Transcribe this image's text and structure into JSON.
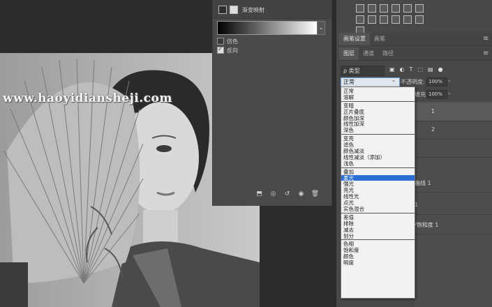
{
  "properties_panel": {
    "title": "渐变映射",
    "options": [
      {
        "label": "仿色",
        "checked": false
      },
      {
        "label": "反向",
        "checked": true
      }
    ],
    "footer_icons": [
      "clip-to-layer-icon",
      "eye-preview-icon",
      "reset-icon",
      "visibility-icon",
      "trash-icon"
    ]
  },
  "right_panel": {
    "top_tabs": [
      {
        "label": "画笔设置",
        "active": true
      },
      {
        "label": "画笔",
        "active": false
      }
    ],
    "layer_tabs": [
      {
        "label": "图层",
        "active": true
      },
      {
        "label": "通道",
        "active": false
      },
      {
        "label": "路径",
        "active": false
      }
    ],
    "filter": {
      "value": "ρ 类型"
    },
    "blend_mode": {
      "selected": "正常"
    },
    "opacity": {
      "label": "不透明度:",
      "value": "100%"
    },
    "fill": {
      "label": "填充:",
      "value": "100%"
    }
  },
  "layers": [
    {
      "fragment": "1",
      "selected": true
    },
    {
      "fragment": "2",
      "selected": false
    },
    {
      "fragment": "",
      "selected": false
    },
    {
      "fragment": "曲线 1",
      "selected": false
    },
    {
      "fragment": "1",
      "selected": false
    },
    {
      "fragment": "/饱和度 1",
      "selected": false
    }
  ],
  "blend_modes": [
    [
      "正常",
      "溶解"
    ],
    [
      "变暗",
      "正片叠底",
      "颜色加深",
      "线性加深",
      "深色"
    ],
    [
      "变亮",
      "滤色",
      "颜色减淡",
      "线性减淡（添加）",
      "浅色"
    ],
    [
      "叠加",
      "柔光",
      "强光",
      "亮光",
      "线性光",
      "点光",
      "实色混合"
    ],
    [
      "差值",
      "排除",
      "减去",
      "划分"
    ],
    [
      "色相",
      "饱和度",
      "颜色",
      "明度"
    ]
  ],
  "highlighted_mode": "柔光",
  "watermark": "www.haoyidiansheji.com"
}
